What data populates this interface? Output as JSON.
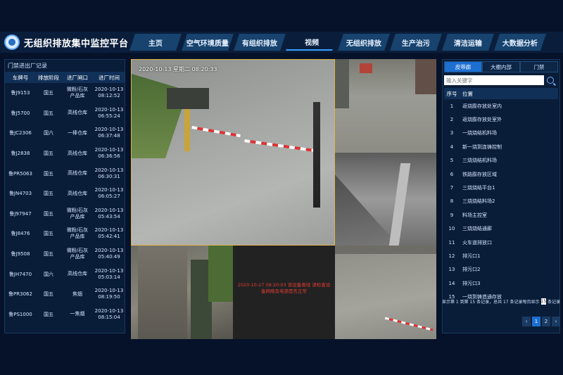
{
  "header": {
    "title": "无组织排放集中监控平台",
    "tabs": [
      {
        "label": "主页",
        "active": false
      },
      {
        "label": "空气环境质量",
        "active": false
      },
      {
        "label": "有组织排放",
        "active": false
      },
      {
        "label": "视频",
        "active": true
      },
      {
        "label": "无组织排放",
        "active": false
      },
      {
        "label": "生产治污",
        "active": false
      },
      {
        "label": "清洁运输",
        "active": false
      },
      {
        "label": "大数据分析",
        "active": false
      }
    ]
  },
  "left_panel": {
    "title": "门禁进出厂记录",
    "columns": [
      "车牌号",
      "排放阶段",
      "进厂闸口",
      "进厂时间"
    ],
    "rows": [
      {
        "plate": "鲁J9153",
        "stage": "国五",
        "gate": [
          "微粉/石灰",
          "产品库"
        ],
        "time": [
          "2020-10-13",
          "08:12:52"
        ]
      },
      {
        "plate": "鲁J5700",
        "stage": "国五",
        "gate": [
          "高线仓库"
        ],
        "time": [
          "2020-10-13",
          "06:55:24"
        ]
      },
      {
        "plate": "鲁JC2306",
        "stage": "国六",
        "gate": [
          "一棒仓库"
        ],
        "time": [
          "2020-10-13",
          "06:37:48"
        ]
      },
      {
        "plate": "鲁J2838",
        "stage": "国五",
        "gate": [
          "高线仓库"
        ],
        "time": [
          "2020-10-13",
          "06:36:56"
        ]
      },
      {
        "plate": "鲁PR5063",
        "stage": "国五",
        "gate": [
          "高线仓库"
        ],
        "time": [
          "2020-10-13",
          "06:30:31"
        ]
      },
      {
        "plate": "鲁JN4703",
        "stage": "国五",
        "gate": [
          "高线仓库"
        ],
        "time": [
          "2020-10-13",
          "06:05:27"
        ]
      },
      {
        "plate": "鲁J97947",
        "stage": "国五",
        "gate": [
          "微粉/石灰",
          "产品库"
        ],
        "time": [
          "2020-10-13",
          "05:43:54"
        ]
      },
      {
        "plate": "鲁J8476",
        "stage": "国五",
        "gate": [
          "微粉/石灰",
          "产品库"
        ],
        "time": [
          "2020-10-13",
          "05:42:41"
        ]
      },
      {
        "plate": "鲁J9508",
        "stage": "国五",
        "gate": [
          "微粉/石灰",
          "产品库"
        ],
        "time": [
          "2020-10-13",
          "05:40:49"
        ]
      },
      {
        "plate": "鲁JH7470",
        "stage": "国六",
        "gate": [
          "高线仓库"
        ],
        "time": [
          "2020-10-13",
          "05:03:14"
        ]
      },
      {
        "plate": "鲁PR3062",
        "stage": "国五",
        "gate": [
          "焦烟"
        ],
        "time": [
          "2020-10-13",
          "08:19:50"
        ]
      },
      {
        "plate": "鲁PS1000",
        "stage": "国五",
        "gate": [
          "一焦烟"
        ],
        "time": [
          "2020-10-13",
          "08:15:04"
        ]
      }
    ]
  },
  "videos": {
    "main_osd": "2020-10-13 星期二 08:20:33",
    "offline_message": "2020-10-27 08:20:03 该设备离线 请检查设备网络及电源是否正常"
  },
  "right_panel": {
    "tabs": [
      {
        "label": "皮带廊",
        "active": true
      },
      {
        "label": "大棚内部",
        "active": false
      },
      {
        "label": "门禁",
        "active": false
      }
    ],
    "search_placeholder": "输入关键字",
    "columns": [
      "序号",
      "位置"
    ],
    "rows": [
      {
        "no": "1",
        "location": "返烧膨存放处室内"
      },
      {
        "no": "2",
        "location": "返烧膨存放处室外"
      },
      {
        "no": "3",
        "location": "一烧烧结机料场"
      },
      {
        "no": "4",
        "location": "新一烧到连铸控制"
      },
      {
        "no": "5",
        "location": "三烧烧结机料场"
      },
      {
        "no": "6",
        "location": "铁路膨存放区域"
      },
      {
        "no": "7",
        "location": "三烧烧结平台1"
      },
      {
        "no": "8",
        "location": "三烧烧结料场2"
      },
      {
        "no": "9",
        "location": "料场主控室"
      },
      {
        "no": "10",
        "location": "三烧烧结通廊"
      },
      {
        "no": "11",
        "location": "火车道排放口"
      },
      {
        "no": "12",
        "location": "排污口1"
      },
      {
        "no": "13",
        "location": "排污口2"
      },
      {
        "no": "14",
        "location": "排污口3"
      },
      {
        "no": "15",
        "location": "一烧到铸造通存放"
      }
    ],
    "footer_prefix": "显示第 1 到第 15 条记录，总共 17 条记录每页显示",
    "page_size": "15",
    "footer_suffix": "条记录",
    "pager": {
      "prev": "‹",
      "pages": [
        "1",
        "2"
      ],
      "next": "›",
      "current": "1"
    }
  }
}
